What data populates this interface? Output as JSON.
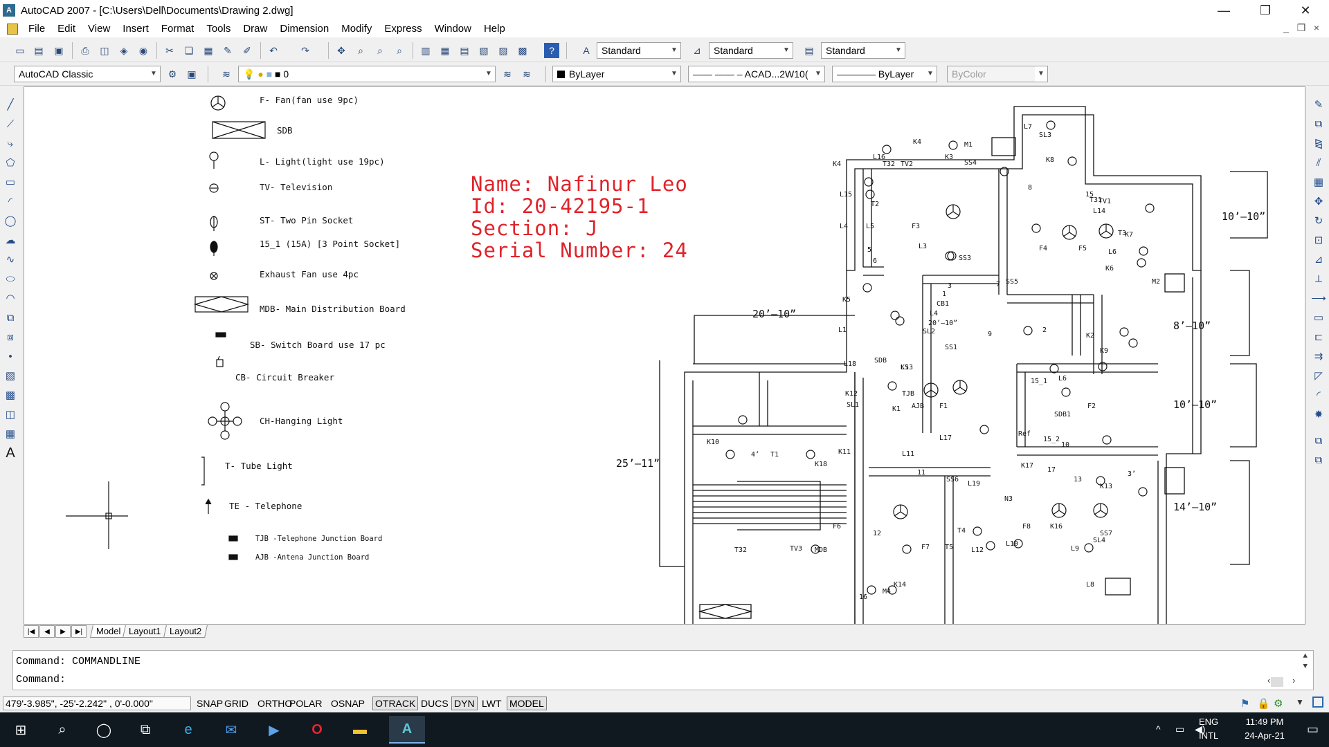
{
  "window": {
    "title": "AutoCAD 2007 - [C:\\Users\\Dell\\Documents\\Drawing 2.dwg]",
    "minimize": "—",
    "restore": "❐",
    "close": "✕"
  },
  "menu": [
    "File",
    "Edit",
    "View",
    "Insert",
    "Format",
    "Tools",
    "Draw",
    "Dimension",
    "Modify",
    "Express",
    "Window",
    "Help"
  ],
  "toolbar": {
    "text_style": "Standard",
    "dim_style": "Standard",
    "table_style": "Standard",
    "workspace": "AutoCAD Classic",
    "layer": "0",
    "color": "ByLayer",
    "linetype": "—— —— – ACAD...2W10(",
    "lineweight": "———— ByLayer",
    "plotstyle": "ByColor"
  },
  "legend": [
    {
      "icon": "fan-symbol",
      "text": "F- Fan(fan use 9pc)"
    },
    {
      "icon": "sdb-symbol",
      "text": "SDB"
    },
    {
      "icon": "light-symbol",
      "text": "L- Light(light use 19pc)"
    },
    {
      "icon": "tv-symbol",
      "text": "TV- Television"
    },
    {
      "icon": "two-pin-socket-symbol",
      "text": "ST- Two Pin Socket"
    },
    {
      "icon": "three-point-socket-symbol",
      "text": "15_1 (15A) [3 Point Socket]"
    },
    {
      "icon": "exhaust-fan-symbol",
      "text": "Exhaust Fan use 4pc"
    },
    {
      "icon": "mdb-symbol",
      "text": "MDB- Main Distribution Board"
    },
    {
      "icon": "switch-board-symbol",
      "text": "SB- Switch Board use 17 pc"
    },
    {
      "icon": "circuit-breaker-symbol",
      "text": "CB- Circuit Breaker"
    },
    {
      "icon": "hanging-light-symbol",
      "text": "CH-Hanging Light"
    },
    {
      "icon": "tube-light-symbol",
      "text": "T- Tube Light"
    },
    {
      "icon": "telephone-symbol",
      "text": "TE - Telephone"
    },
    {
      "icon": "tjb-symbol",
      "text": "TJB -Telephone Junction Board"
    },
    {
      "icon": "ajb-symbol",
      "text": "AJB -Antena Junction Board"
    }
  ],
  "student": {
    "name": "Name: Nafinur Leo",
    "id": "Id: 20-42195-1",
    "section": "Section: J",
    "serial": "Serial Number: 24"
  },
  "dimensions": [
    "20’–10”",
    "25’–11”",
    "10’–10”",
    "8’–10”",
    "10’–10”",
    "14’–10”"
  ],
  "plan_labels": [
    "K4",
    "M1",
    "L7",
    "SL3",
    "K8",
    "L16",
    "T32",
    "TV2",
    "K3",
    "SS4",
    "8",
    "15",
    "K4",
    "L15",
    "T2",
    "F3",
    "T31",
    "TV1",
    "L14",
    "L4",
    "L5",
    "F4",
    "F5",
    "T3",
    "K7",
    "5",
    "L3",
    "SS3",
    "6",
    "L6",
    "K6",
    "M2",
    "K5",
    "3",
    "7",
    "SS5",
    "1",
    "CB1",
    "L4",
    "L1",
    "20’–10”",
    "SL2",
    "SS1",
    "2",
    "9",
    "K2",
    "K9",
    "L18",
    "SDB",
    "15_1",
    "L6",
    "K12",
    "SL1",
    "TJB",
    "AJB",
    "K1",
    "F1",
    "F2",
    "SDB1",
    "Ref",
    "L17",
    "10",
    "15_2",
    "K10",
    "K11",
    "L11",
    "4’",
    "T1",
    "K18",
    "K17",
    "17",
    "11",
    "SS6",
    "13",
    "3’",
    "K13",
    "L19",
    "N3",
    "12",
    "T4",
    "F8",
    "K16",
    "F6",
    "F7",
    "T5",
    "SS7",
    "SL4",
    "T32",
    "TV3",
    "MDB",
    "L12",
    "L10",
    "L9",
    "K14",
    "L8",
    "16",
    "M4",
    "K5",
    "L13"
  ],
  "layout_tabs": [
    "Model",
    "Layout1",
    "Layout2"
  ],
  "command": {
    "history": "Command: COMMANDLINE",
    "prompt": "Command:",
    "input": ""
  },
  "status": {
    "coords": "479'-3.985\",  -25'-2.242\" , 0'-0.000\"",
    "toggles": [
      {
        "label": "SNAP",
        "on": false
      },
      {
        "label": "GRID",
        "on": false
      },
      {
        "label": "ORTHO",
        "on": false
      },
      {
        "label": "POLAR",
        "on": false
      },
      {
        "label": "OSNAP",
        "on": false
      },
      {
        "label": "OTRACK",
        "on": true
      },
      {
        "label": "DUCS",
        "on": false
      },
      {
        "label": "DYN",
        "on": true
      },
      {
        "label": "LWT",
        "on": false
      },
      {
        "label": "MODEL",
        "on": true
      }
    ]
  },
  "taskbar": {
    "lang1": "ENG",
    "lang2": "INTL",
    "time": "11:49 PM",
    "date": "24-Apr-21"
  }
}
